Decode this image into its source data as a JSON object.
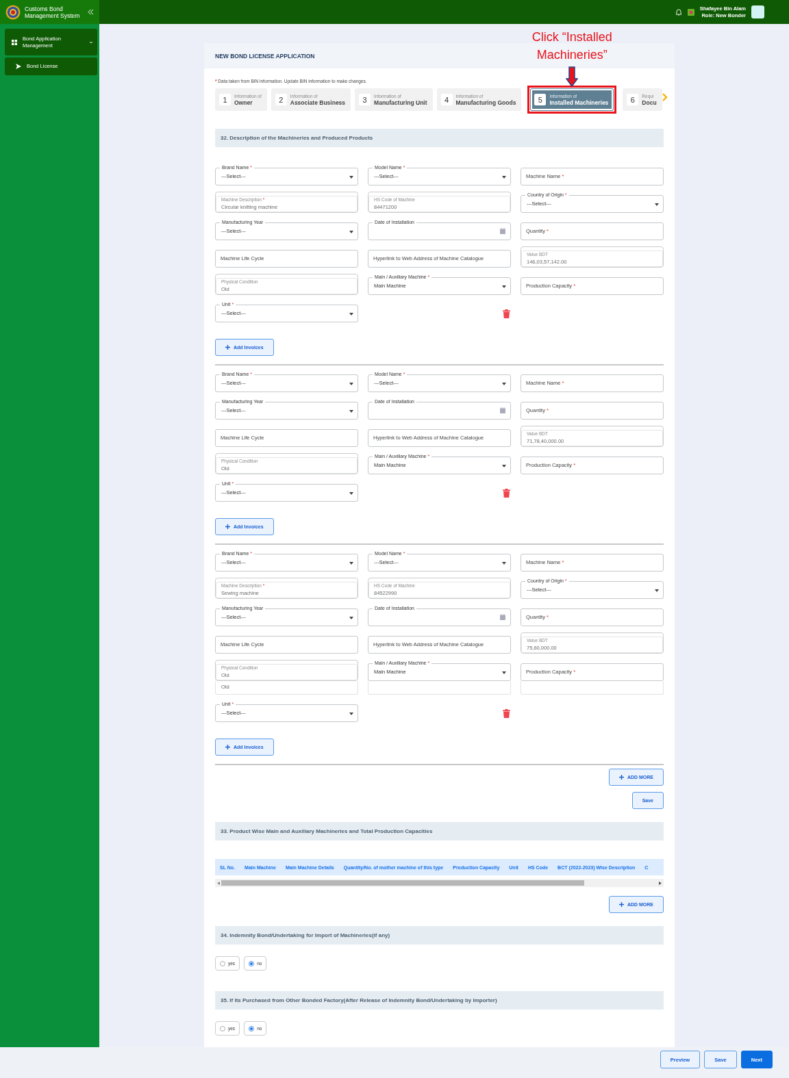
{
  "header": {
    "app_title": "Customs Bond Management System",
    "user_name": "Shafayee Bin Alam",
    "user_role": "Role: New Bonder"
  },
  "sidebar": {
    "items": [
      {
        "label": "Bond Application Management",
        "expanded": true,
        "children": [
          {
            "label": "Bond License"
          }
        ]
      }
    ]
  },
  "page_title": "NEW BOND LICENSE APPLICATION",
  "annotation": "Click “Installed Machineries”",
  "note": {
    "mark": "*",
    "text": "Data taken from BIN information. Update BIN information to make changes."
  },
  "tabs": [
    {
      "number": "1",
      "caption": "Information of",
      "label": "Owner",
      "selected": false
    },
    {
      "number": "2",
      "caption": "Information of",
      "label": "Associate Business",
      "selected": false
    },
    {
      "number": "3",
      "caption": "Information of",
      "label": "Manufacturing Unit",
      "selected": false
    },
    {
      "number": "4",
      "caption": "Information of",
      "label": "Manufacturing Goods",
      "selected": false
    },
    {
      "number": "5",
      "caption": "Information of",
      "label": "Installed Machineries",
      "selected": true
    },
    {
      "number": "6",
      "caption": "Requi",
      "label": "Docu",
      "selected": false
    }
  ],
  "section_32": {
    "title": "32. Description of the Machineries and Produced Products",
    "machines": [
      {
        "add_invoices": "Add Invoices",
        "fields": [
          {
            "kind": "select",
            "label": "Brand Name",
            "required_mark": "*",
            "value": "---Select---"
          },
          {
            "kind": "select",
            "label": "Model Name",
            "required_mark": "*",
            "value": "---Select---"
          },
          {
            "kind": "text",
            "placeholder": "Machine Name",
            "required_mark": "*"
          },
          {
            "kind": "readonly",
            "label": "Machine Description",
            "required_mark": "*",
            "value": "Circular knitting machine"
          },
          {
            "kind": "readonly",
            "label": "HS Code of Machine",
            "value": "84471200"
          },
          {
            "kind": "select",
            "label": "Country of Origin",
            "required_mark": "*",
            "value": "---Select---"
          },
          {
            "kind": "select",
            "label": "Manufacturing Year",
            "value": "---Select---"
          },
          {
            "kind": "date",
            "label": "Date of Installation"
          },
          {
            "kind": "text",
            "placeholder": "Quantity",
            "required_mark": "*"
          },
          {
            "kind": "text",
            "placeholder": "Machine Life Cycle"
          },
          {
            "kind": "text",
            "placeholder": "Hyperlink to Web Address of Machine Catalogue"
          },
          {
            "kind": "readonly",
            "label": "Value BDT",
            "value": "146,03,57,142.00"
          },
          {
            "kind": "readonly",
            "label": "Physical Condition",
            "value": "Old"
          },
          {
            "kind": "select",
            "label": "Main / Auxiliary Machine",
            "required_mark": "*",
            "value": "Main Machine"
          },
          {
            "kind": "text",
            "placeholder": "Production Capacity",
            "required_mark": "*"
          },
          {
            "kind": "select",
            "label": "Unit",
            "required_mark": "*",
            "value": "---Select---"
          }
        ]
      },
      {
        "add_invoices": "Add Invoices",
        "fields": [
          {
            "kind": "select",
            "label": "Brand Name",
            "required_mark": "*",
            "value": "---Select---"
          },
          {
            "kind": "select",
            "label": "Model Name",
            "required_mark": "*",
            "value": "---Select---"
          },
          {
            "kind": "text",
            "placeholder": "Machine Name",
            "required_mark": "*"
          },
          {
            "kind": "select",
            "label": "Manufacturing Year",
            "value": "---Select---"
          },
          {
            "kind": "date",
            "label": "Date of Installation"
          },
          {
            "kind": "text",
            "placeholder": "Quantity",
            "required_mark": "*"
          },
          {
            "kind": "text",
            "placeholder": "Machine Life Cycle"
          },
          {
            "kind": "text",
            "placeholder": "Hyperlink to Web Address of Machine Catalogue"
          },
          {
            "kind": "readonly",
            "label": "Value BDT",
            "value": "71,78,40,000.00"
          },
          {
            "kind": "readonly",
            "label": "Physical Condition",
            "value": "Old"
          },
          {
            "kind": "select",
            "label": "Main / Auxiliary Machine",
            "required_mark": "*",
            "value": "Main Machine"
          },
          {
            "kind": "text",
            "placeholder": "Production Capacity",
            "required_mark": "*"
          },
          {
            "kind": "select",
            "label": "Unit",
            "required_mark": "*",
            "value": "---Select---"
          }
        ]
      },
      {
        "add_invoices": "Add Invoices",
        "fields": [
          {
            "kind": "select",
            "label": "Brand Name",
            "required_mark": "*",
            "value": "---Select---"
          },
          {
            "kind": "select",
            "label": "Model Name",
            "required_mark": "*",
            "value": "---Select---"
          },
          {
            "kind": "text",
            "placeholder": "Machine Name",
            "required_mark": "*"
          },
          {
            "kind": "readonly",
            "label": "Machine Description",
            "required_mark": "*",
            "value": "Sewing machine"
          },
          {
            "kind": "readonly",
            "label": "HS Code of Machine",
            "value": "84522990"
          },
          {
            "kind": "select",
            "label": "Country of Origin",
            "required_mark": "*",
            "value": "---Select---"
          },
          {
            "kind": "select",
            "label": "Manufacturing Year",
            "value": "---Select---"
          },
          {
            "kind": "date",
            "label": "Date of Installation"
          },
          {
            "kind": "text",
            "placeholder": "Quantity",
            "required_mark": "*"
          },
          {
            "kind": "text",
            "placeholder": "Machine Life Cycle"
          },
          {
            "kind": "text",
            "placeholder": "Hyperlink to Web Address of Machine Catalogue"
          },
          {
            "kind": "readonly",
            "label": "Value BDT",
            "value": "75,60,000.00"
          },
          {
            "kind": "readonly",
            "label": "Physical Condition",
            "value": "Old"
          },
          {
            "kind": "select",
            "label": "Main / Auxiliary Machine",
            "required_mark": "*",
            "value": "Main Machine"
          },
          {
            "kind": "text",
            "placeholder": "Production Capacity",
            "required_mark": "*"
          },
          {
            "kind": "plain",
            "value": "Old"
          },
          {
            "kind": "blank"
          },
          {
            "kind": "blank"
          },
          {
            "kind": "select",
            "label": "Unit",
            "required_mark": "*",
            "value": "---Select---"
          }
        ]
      }
    ],
    "add_more": "ADD MORE",
    "save": "Save"
  },
  "section_33": {
    "title": "33. Product Wise Main and Auxiliary Machineries and Total Production Capacities",
    "columns": [
      "SL No.",
      "Main Machine",
      "Main Machine Details",
      "Quantity/No. of mother machine of this type",
      "Production Capacity",
      "Unit",
      "HS Code",
      "BCT (2022-2023) Wise Description",
      "C"
    ],
    "add_more": "ADD MORE"
  },
  "section_34": {
    "title": "34. Indemnity Bond/Undertaking for Import of Machineries(if any)",
    "options": [
      {
        "label": "yes",
        "selected": false
      },
      {
        "label": "no",
        "selected": true
      }
    ]
  },
  "section_35": {
    "title": "35. If Its Purchased from Other Bonded Factory(After Release of Indemnity Bond/Undertaking by Importer)",
    "options": [
      {
        "label": "yes",
        "selected": false
      },
      {
        "label": "no",
        "selected": true
      }
    ]
  },
  "footer": {
    "buttons": [
      {
        "label": "Preview",
        "kind": "outline"
      },
      {
        "label": "Save",
        "kind": "outline"
      },
      {
        "label": "Next",
        "kind": "primary"
      }
    ]
  }
}
